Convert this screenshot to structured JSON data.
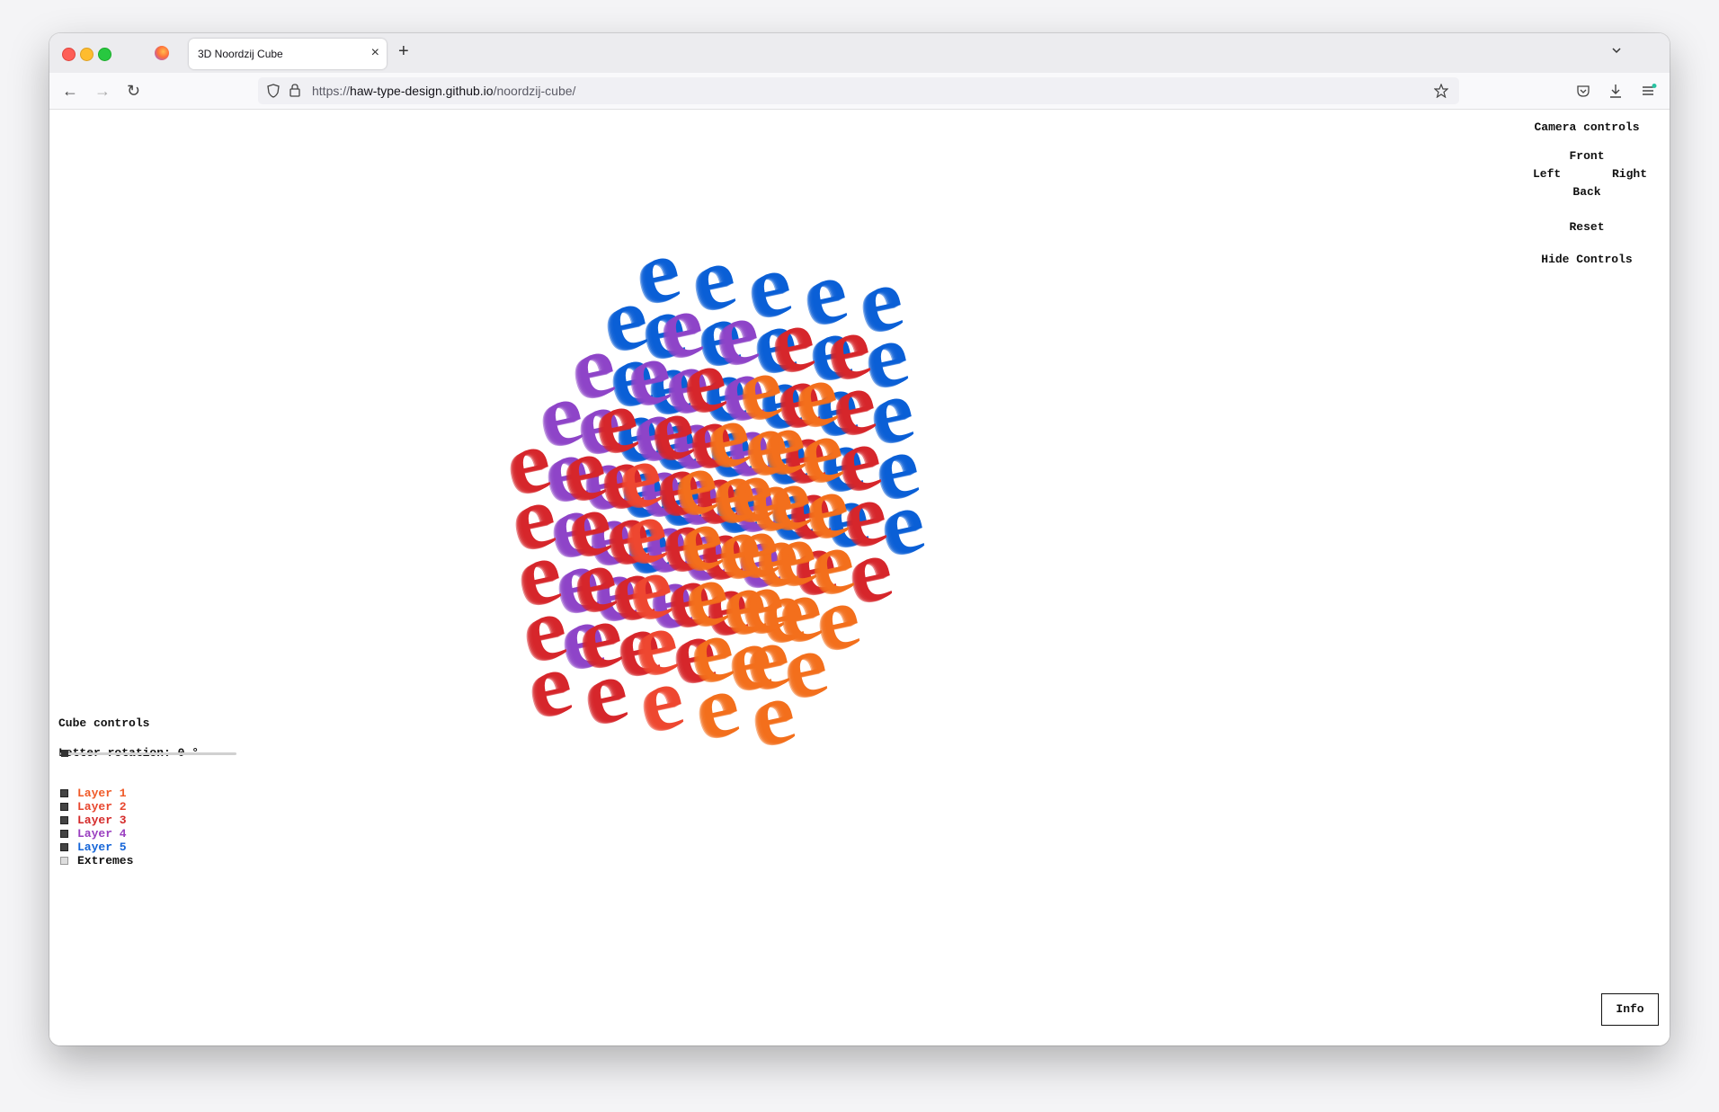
{
  "browser": {
    "tab_title": "3D Noordzij Cube",
    "tab_close_icon": "close-icon",
    "new_tab_icon": "plus-icon",
    "url_prefix": "https://",
    "url_host": "haw-type-design.github.io",
    "url_path": "/noordzij-cube/"
  },
  "camera_controls": {
    "heading": "Camera controls",
    "front": "Front",
    "left": "Left",
    "right": "Right",
    "back": "Back",
    "reset": "Reset",
    "hide": "Hide Controls"
  },
  "cube_controls": {
    "heading": "Cube controls",
    "rotation_label": "Letter rotation: 0 °",
    "rotation_value": 0,
    "layers": [
      {
        "label": "Layer 1",
        "color": "#f05a28",
        "checked": true
      },
      {
        "label": "Layer 2",
        "color": "#e8472f",
        "checked": true
      },
      {
        "label": "Layer 3",
        "color": "#d42a2a",
        "checked": true
      },
      {
        "label": "Layer 4",
        "color": "#9a3fc0",
        "checked": true
      },
      {
        "label": "Layer 5",
        "color": "#1565d8",
        "checked": true
      },
      {
        "label": "Extremes",
        "color": "#111111",
        "checked": false
      }
    ]
  },
  "info_button": "Info",
  "cube_letter": "e",
  "palette": {
    "blue": "#0a5fd6",
    "purple": "#8e44c8",
    "red": "#d6262b",
    "red_orange": "#ee4730",
    "orange": "#f36f1c"
  }
}
